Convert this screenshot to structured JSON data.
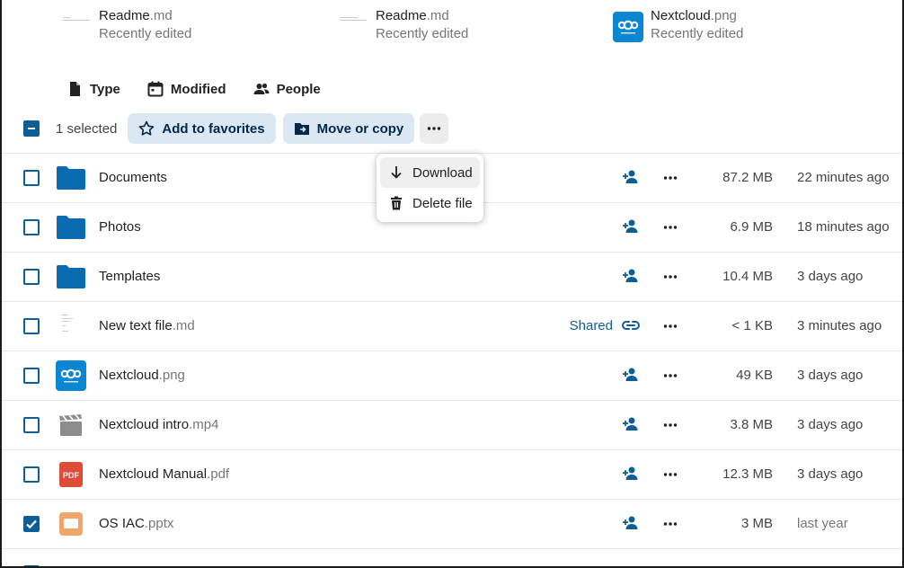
{
  "recent": [
    {
      "name": "Readme",
      "ext": ".md",
      "sub": "Recently edited",
      "thumb": "doc"
    },
    {
      "name": "Readme",
      "ext": ".md",
      "sub": "Recently edited",
      "thumb": "doc"
    },
    {
      "name": "Nextcloud",
      "ext": ".png",
      "sub": "Recently edited",
      "thumb": "nextcloud-logo"
    }
  ],
  "filters": {
    "type": {
      "label": "Type",
      "icon": "file-icon"
    },
    "modified": {
      "label": "Modified",
      "icon": "calendar-icon"
    },
    "people": {
      "label": "People",
      "icon": "people-icon"
    }
  },
  "toolbar": {
    "selected_label": "1 selected",
    "favorites_label": "Add to favorites",
    "move_label": "Move or copy"
  },
  "menu": {
    "download_label": "Download",
    "delete_label": "Delete file"
  },
  "files": [
    {
      "name": "Documents",
      "ext": "",
      "icon": "folder-icon",
      "share": "",
      "size": "87.2 MB",
      "modified": "22 minutes ago",
      "checked": false
    },
    {
      "name": "Photos",
      "ext": "",
      "icon": "folder-icon",
      "share": "",
      "size": "6.9 MB",
      "modified": "18 minutes ago",
      "checked": false
    },
    {
      "name": "Templates",
      "ext": "",
      "icon": "folder-icon",
      "share": "",
      "size": "10.4 MB",
      "modified": "3 days ago",
      "checked": false
    },
    {
      "name": "New text file",
      "ext": ".md",
      "icon": "text-file-icon",
      "share": "Shared",
      "size": "< 1 KB",
      "modified": "3 minutes ago",
      "checked": false
    },
    {
      "name": "Nextcloud",
      "ext": ".png",
      "icon": "nextcloud-image-icon",
      "share": "",
      "size": "49 KB",
      "modified": "3 days ago",
      "checked": false
    },
    {
      "name": "Nextcloud intro",
      "ext": ".mp4",
      "icon": "video-icon",
      "share": "",
      "size": "3.8 MB",
      "modified": "3 days ago",
      "checked": false
    },
    {
      "name": "Nextcloud Manual",
      "ext": ".pdf",
      "icon": "pdf-icon",
      "share": "",
      "size": "12.3 MB",
      "modified": "3 days ago",
      "checked": false
    },
    {
      "name": "OS IAC",
      "ext": ".pptx",
      "icon": "presentation-icon",
      "share": "",
      "size": "3 MB",
      "modified": "last year",
      "checked": true
    }
  ],
  "colors": {
    "primary": "#0d5e96",
    "folder": "#0b6bb0",
    "toolbar_button_bg": "#dbe8f3",
    "pdf": "#dd4b39",
    "presentation": "#f2a56a",
    "video": "#8c8c8c"
  }
}
